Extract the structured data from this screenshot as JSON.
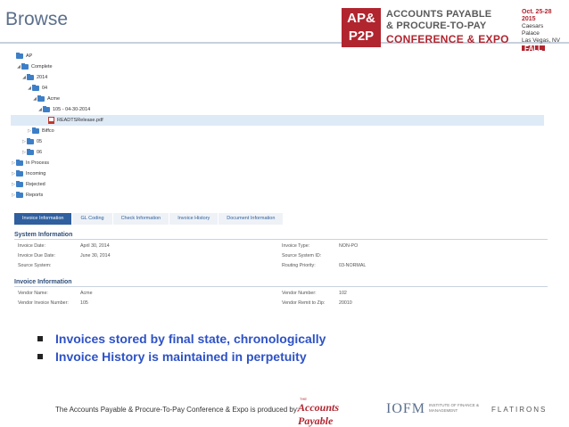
{
  "slide": {
    "title": "Browse",
    "bullets": [
      "Invoices stored by final state, chronologically",
      "Invoice History is maintained in perpetuity"
    ],
    "footer_text": "The Accounts Payable & Procure-To-Pay Conference & Expo is produced by:"
  },
  "logo": {
    "mark": "AP&P2P",
    "line1": "ACCOUNTS PAYABLE",
    "line2": "& PROCURE-TO-PAY",
    "line3": "CONFERENCE & EXPO",
    "date": "Oct. 25-28",
    "year": "2015",
    "venue1": "Caesars Palace",
    "venue2": "Las Vegas, NV",
    "season": "FALL"
  },
  "footer_logos": {
    "ap_small": "THE",
    "ap_name": "Accounts Payable",
    "iofm": "IOFM",
    "iofm_sub": "INSTITUTE OF FINANCE & MANAGEMENT",
    "flatirons": "FLATIRONS"
  },
  "tree": [
    {
      "label": "AP",
      "type": "folder",
      "arrow": ""
    },
    {
      "label": "Complete",
      "type": "folder",
      "arrow": "◢"
    },
    {
      "label": "2014",
      "type": "folder",
      "arrow": "◢"
    },
    {
      "label": "04",
      "type": "folder",
      "arrow": "◢"
    },
    {
      "label": "Acme",
      "type": "folder",
      "arrow": "◢"
    },
    {
      "label": "105 - 04-30-2014",
      "type": "folder",
      "arrow": "◢"
    },
    {
      "label": "READTSRelease.pdf",
      "type": "pdf",
      "arrow": ""
    },
    {
      "label": "Biffco",
      "type": "folder",
      "arrow": "▷"
    },
    {
      "label": "05",
      "type": "folder",
      "arrow": "▷"
    },
    {
      "label": "06",
      "type": "folder",
      "arrow": "▷"
    },
    {
      "label": "In Process",
      "type": "folder",
      "arrow": "▷"
    },
    {
      "label": "Incoming",
      "type": "folder",
      "arrow": "▷"
    },
    {
      "label": "Rejected",
      "type": "folder",
      "arrow": "▷"
    },
    {
      "label": "Reports",
      "type": "folder",
      "arrow": "▷"
    }
  ],
  "tabs": [
    "Invoice Information",
    "GL Coding",
    "Check Information",
    "Invoice History",
    "Document Information"
  ],
  "system_info": {
    "heading": "System Information",
    "rows": [
      {
        "l1": "Invoice Date:",
        "v1": "April 30, 2014",
        "l2": "Invoice Type:",
        "v2": "NON-PO"
      },
      {
        "l1": "Invoice Due Date:",
        "v1": "June 30, 2014",
        "l2": "Source System ID:",
        "v2": ""
      },
      {
        "l1": "Source System:",
        "v1": "",
        "l2": "Routing Priority:",
        "v2": "03-NORMAL"
      }
    ]
  },
  "invoice_info": {
    "heading": "Invoice Information",
    "rows": [
      {
        "l1": "Vendor Name:",
        "v1": "Acme",
        "l2": "Vendor Number:",
        "v2": "102"
      },
      {
        "l1": "Vendor Invoice Number:",
        "v1": "105",
        "l2": "Vendor Remit to Zip:",
        "v2": "20010"
      }
    ]
  },
  "colors": {
    "title": "#5b6f8c",
    "bullet_text": "#2e52c7",
    "brand_red": "#b1252f",
    "folder_blue": "#3d7fc7",
    "active_tab": "#2f5f9e"
  }
}
